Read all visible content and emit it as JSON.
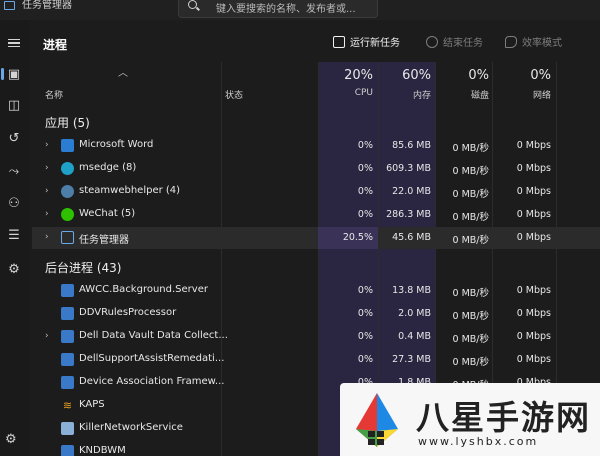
{
  "window": {
    "title": "任务管理器"
  },
  "search": {
    "placeholder": "键入要搜索的名称、发布者或..."
  },
  "rail": {
    "icons": [
      "menu-icon",
      "processes-icon",
      "performance-icon",
      "app-history-icon",
      "startup-apps-icon",
      "users-icon",
      "details-icon",
      "services-icon",
      "settings-icon"
    ]
  },
  "header": {
    "title": "进程",
    "run_new_task": "运行新任务",
    "end_task": "结束任务",
    "efficiency_mode": "效率模式"
  },
  "columns": {
    "name": "名称",
    "status": "状态",
    "cpu_pct": "20%",
    "cpu": "CPU",
    "mem_pct": "60%",
    "mem": "内存",
    "disk_pct": "0%",
    "disk": "磁盘",
    "net_pct": "0%",
    "net": "网络"
  },
  "groups": {
    "apps": "应用 (5)",
    "background": "后台进程 (43)"
  },
  "apps": [
    {
      "name": "Microsoft Word",
      "cpu": "0%",
      "mem": "85.6 MB",
      "disk": "0 MB/秒",
      "net": "0 Mbps",
      "icon": "word-icon",
      "color": "#2b7cd3"
    },
    {
      "name": "msedge (8)",
      "cpu": "0%",
      "mem": "609.3 MB",
      "disk": "0 MB/秒",
      "net": "0 Mbps",
      "icon": "edge-icon",
      "color": "#1fa0c8"
    },
    {
      "name": "steamwebhelper (4)",
      "cpu": "0%",
      "mem": "22.0 MB",
      "disk": "0 MB/秒",
      "net": "0 Mbps",
      "icon": "steam-icon",
      "color": "#4d7ea8"
    },
    {
      "name": "WeChat (5)",
      "cpu": "0%",
      "mem": "286.3 MB",
      "disk": "0 MB/秒",
      "net": "0 Mbps",
      "icon": "wechat-icon",
      "color": "#2dc100"
    },
    {
      "name": "任务管理器",
      "cpu": "20.5%",
      "mem": "45.6 MB",
      "disk": "0 MB/秒",
      "net": "0 Mbps",
      "icon": "task-manager-icon",
      "color": "#6aa7e8"
    }
  ],
  "background": [
    {
      "name": "AWCC.Background.Server",
      "cpu": "0%",
      "mem": "13.8 MB",
      "disk": "0 MB/秒",
      "net": "0 Mbps",
      "icon": "service-icon",
      "color": "#3a78c8",
      "chevron": false
    },
    {
      "name": "DDVRulesProcessor",
      "cpu": "0%",
      "mem": "2.0 MB",
      "disk": "0 MB/秒",
      "net": "0 Mbps",
      "icon": "service-icon",
      "color": "#3a78c8",
      "chevron": false
    },
    {
      "name": "Dell Data Vault Data Collect...",
      "cpu": "0%",
      "mem": "0.4 MB",
      "disk": "0 MB/秒",
      "net": "0 Mbps",
      "icon": "service-icon",
      "color": "#3a78c8",
      "chevron": true
    },
    {
      "name": "DellSupportAssistRemedati...",
      "cpu": "0%",
      "mem": "27.3 MB",
      "disk": "0 MB/秒",
      "net": "0 Mbps",
      "icon": "service-icon",
      "color": "#3a78c8",
      "chevron": false
    },
    {
      "name": "Device Association Framew...",
      "cpu": "0%",
      "mem": "1.8 MB",
      "disk": "0 MB/秒",
      "net": "0 Mbps",
      "icon": "service-icon",
      "color": "#3a78c8",
      "chevron": false
    },
    {
      "name": "KAPS",
      "icon": "wifi-icon",
      "color": "#e8a020",
      "chevron": false
    },
    {
      "name": "KillerNetworkService",
      "icon": "killer-icon",
      "color": "#8ab0d8",
      "chevron": false
    },
    {
      "name": "KNDBWM",
      "icon": "service-icon",
      "color": "#3a78c8",
      "chevron": false
    }
  ],
  "watermark": {
    "text": "八星手游网",
    "url": "www.lyshbx.com"
  }
}
